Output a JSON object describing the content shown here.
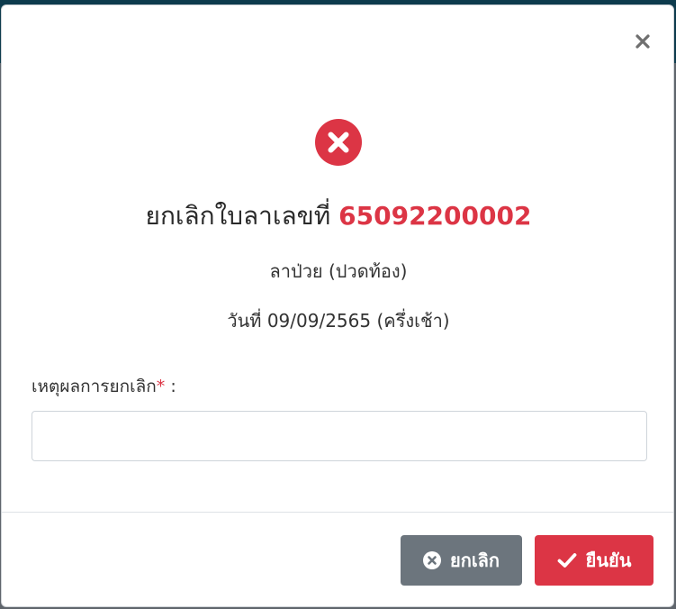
{
  "dialog": {
    "title_prefix": "ยกเลิกใบลาเลขที่",
    "leave_number": "65092200002",
    "leave_type": "ลาป่วย (ปวดท้อง)",
    "leave_date": "วันที่ 09/09/2565 (ครึ่งเช้า)",
    "reason_label": "เหตุผลการยกเลิก",
    "required_mark": "*",
    "reason_suffix": " :",
    "reason_value": "",
    "reason_placeholder": ""
  },
  "buttons": {
    "cancel_label": "ยกเลิก",
    "confirm_label": "ยืนยัน"
  },
  "icons": {
    "close": "close-icon",
    "status": "error-circle-icon",
    "cancel": "times-circle-icon",
    "confirm": "check-icon"
  },
  "colors": {
    "danger": "#dc3545",
    "secondary": "#6c757d"
  }
}
